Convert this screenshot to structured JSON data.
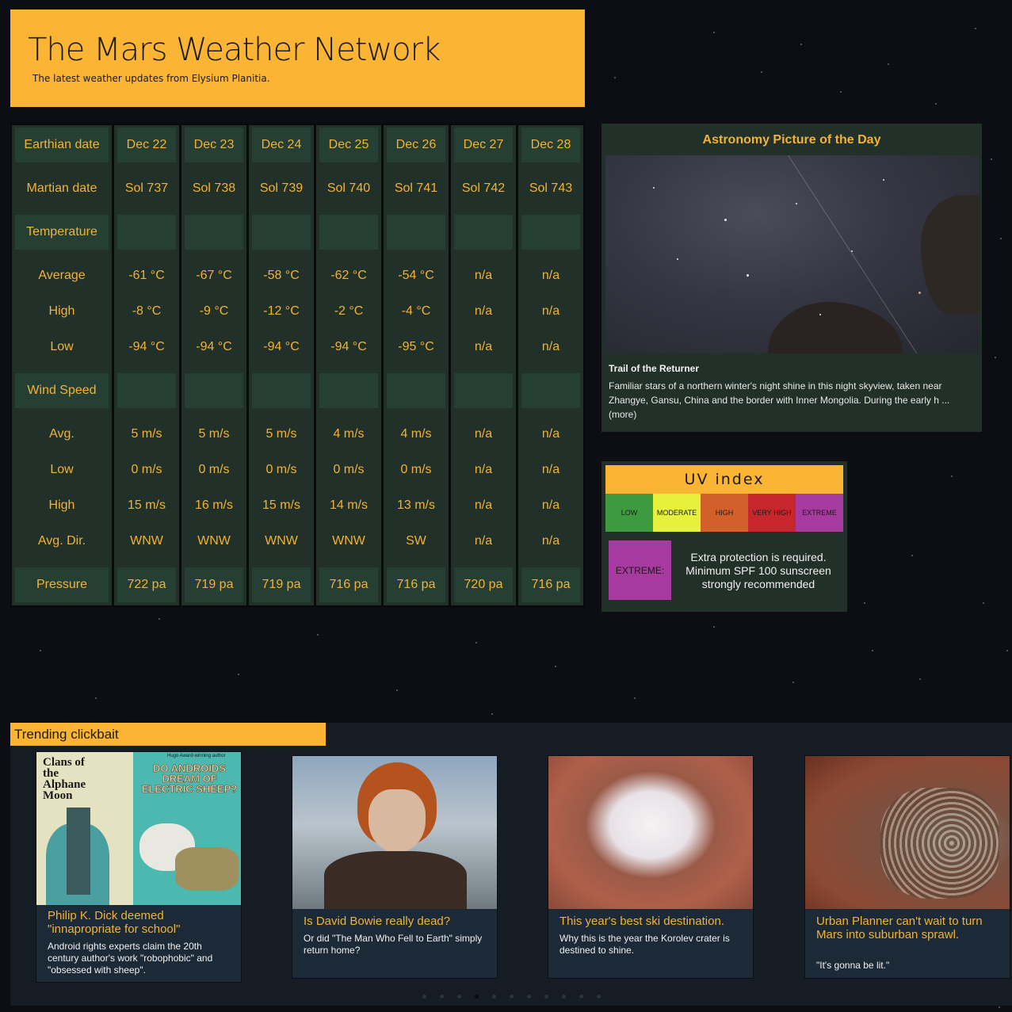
{
  "header": {
    "title": "The Mars Weather Network",
    "subtitle": "The latest weather updates from Elysium Planitia."
  },
  "weather": {
    "row_labels": [
      "Earthian date",
      "Martian date",
      "Temperature",
      "Average",
      "High",
      "Low",
      "Wind Speed",
      "Avg.",
      "Low",
      "High",
      "Avg. Dir.",
      "Pressure"
    ],
    "days": [
      {
        "earth": "Dec 22",
        "sol": "Sol 737",
        "avg": "-61 °C",
        "high": "-8 °C",
        "low": "-94 °C",
        "w_avg": "5 m/s",
        "w_low": "0 m/s",
        "w_high": "15 m/s",
        "w_dir": "WNW",
        "pressure": "722 pa"
      },
      {
        "earth": "Dec 23",
        "sol": "Sol 738",
        "avg": "-67 °C",
        "high": "-9 °C",
        "low": "-94 °C",
        "w_avg": "5 m/s",
        "w_low": "0 m/s",
        "w_high": "16 m/s",
        "w_dir": "WNW",
        "pressure": "719 pa"
      },
      {
        "earth": "Dec 24",
        "sol": "Sol 739",
        "avg": "-58 °C",
        "high": "-12 °C",
        "low": "-94 °C",
        "w_avg": "5 m/s",
        "w_low": "0 m/s",
        "w_high": "15 m/s",
        "w_dir": "WNW",
        "pressure": "719 pa"
      },
      {
        "earth": "Dec 25",
        "sol": "Sol 740",
        "avg": "-62 °C",
        "high": "-2 °C",
        "low": "-94 °C",
        "w_avg": "4 m/s",
        "w_low": "0 m/s",
        "w_high": "14 m/s",
        "w_dir": "WNW",
        "pressure": "716 pa"
      },
      {
        "earth": "Dec 26",
        "sol": "Sol 741",
        "avg": "-54 °C",
        "high": "-4 °C",
        "low": "-95 °C",
        "w_avg": "4 m/s",
        "w_low": "0 m/s",
        "w_high": "13 m/s",
        "w_dir": "SW",
        "pressure": "716 pa"
      },
      {
        "earth": "Dec 27",
        "sol": "Sol 742",
        "avg": "n/a",
        "high": "n/a",
        "low": "n/a",
        "w_avg": "n/a",
        "w_low": "n/a",
        "w_high": "n/a",
        "w_dir": "n/a",
        "pressure": "720 pa"
      },
      {
        "earth": "Dec 28",
        "sol": "Sol 743",
        "avg": "n/a",
        "high": "n/a",
        "low": "n/a",
        "w_avg": "n/a",
        "w_low": "n/a",
        "w_high": "n/a",
        "w_dir": "n/a",
        "pressure": "716 pa"
      }
    ]
  },
  "apod": {
    "heading": "Astronomy Picture of the Day",
    "title": "Trail of the Returner",
    "text": "Familiar stars of a northern winter's night shine in this night skyview, taken near Zhangye, Gansu, China and the border with Inner Mongolia. During the early h ...(more)"
  },
  "uv": {
    "title": "UV index",
    "levels": [
      {
        "label": "LOW",
        "color": "#3e9a3e"
      },
      {
        "label": "MODERATE",
        "color": "#e6f13c"
      },
      {
        "label": "HIGH",
        "color": "#d3602a"
      },
      {
        "label": "VERY HIGH",
        "color": "#c8262d"
      },
      {
        "label": "EXTREME",
        "color": "#a63a9e"
      }
    ],
    "current_label": "EXTREME:",
    "current_note": "Extra protection is required. Minimum SPF 100 sunscreen strongly recommended"
  },
  "trending": {
    "label": "Trending clickbait",
    "cards": [
      {
        "title": "Philip K. Dick deemed \"innapropriate for school\"",
        "body": "Android rights experts claim the 20th century author's work \"robophobic\" and \"obsessed with sheep\".",
        "cover_left": "Clans of the Alphane Moon",
        "cover_right": "DO ANDROIDS DREAM OF ELECTRIC SHEEP?",
        "cover_tag": "Hugo Award-winning author"
      },
      {
        "title": "Is David Bowie really dead?",
        "body": "Or did \"The Man Who Fell to Earth\" simply return home?"
      },
      {
        "title": "This year's best ski destination.",
        "body": "Why this is the year the Korolev crater is destined to shine."
      },
      {
        "title": "Urban Planner can't wait to turn Mars into suburban sprawl.",
        "body": "\"It's gonna be lit.\""
      }
    ],
    "page_count": 11,
    "active_page": 4
  }
}
